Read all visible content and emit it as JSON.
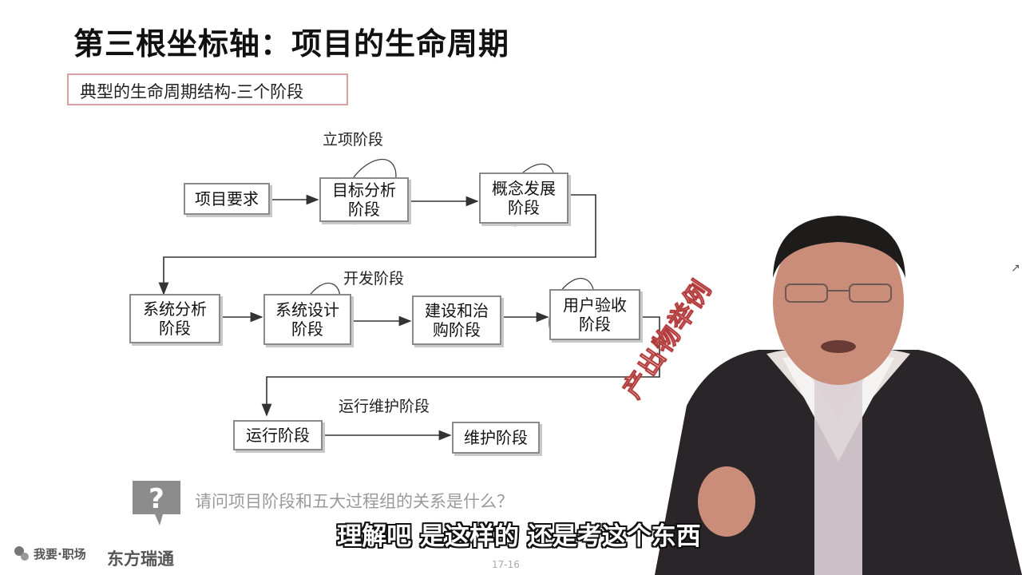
{
  "slide": {
    "title": "第三根坐标轴：项目的生命周期",
    "subtitle": "典型的生命周期结构-三个阶段",
    "page_number": "17-16"
  },
  "phases": {
    "initiation": "立项阶段",
    "development": "开发阶段",
    "operation": "运行维护阶段"
  },
  "boxes": {
    "b1": "项目要求",
    "b2_l1": "目标分析",
    "b2_l2": "阶段",
    "b3_l1": "概念发展",
    "b3_l2": "阶段",
    "b4_l1": "系统分析",
    "b4_l2": "阶段",
    "b5_l1": "系统设计",
    "b5_l2": "阶段",
    "b6_l1": "建设和治",
    "b6_l2": "购阶段",
    "b7_l1": "用户验收",
    "b7_l2": "阶段",
    "b8": "运行阶段",
    "b9": "维护阶段"
  },
  "question": {
    "icon": "question-mark-icon",
    "text": "请问项目阶段和五大过程组的关系是什么？"
  },
  "overlay": {
    "caption": "理解吧 是这样的 还是考这个东西",
    "stamp": "产出物举例"
  },
  "branding": {
    "logo_left": "我要·职场",
    "logo_right": "东方瑞通"
  }
}
